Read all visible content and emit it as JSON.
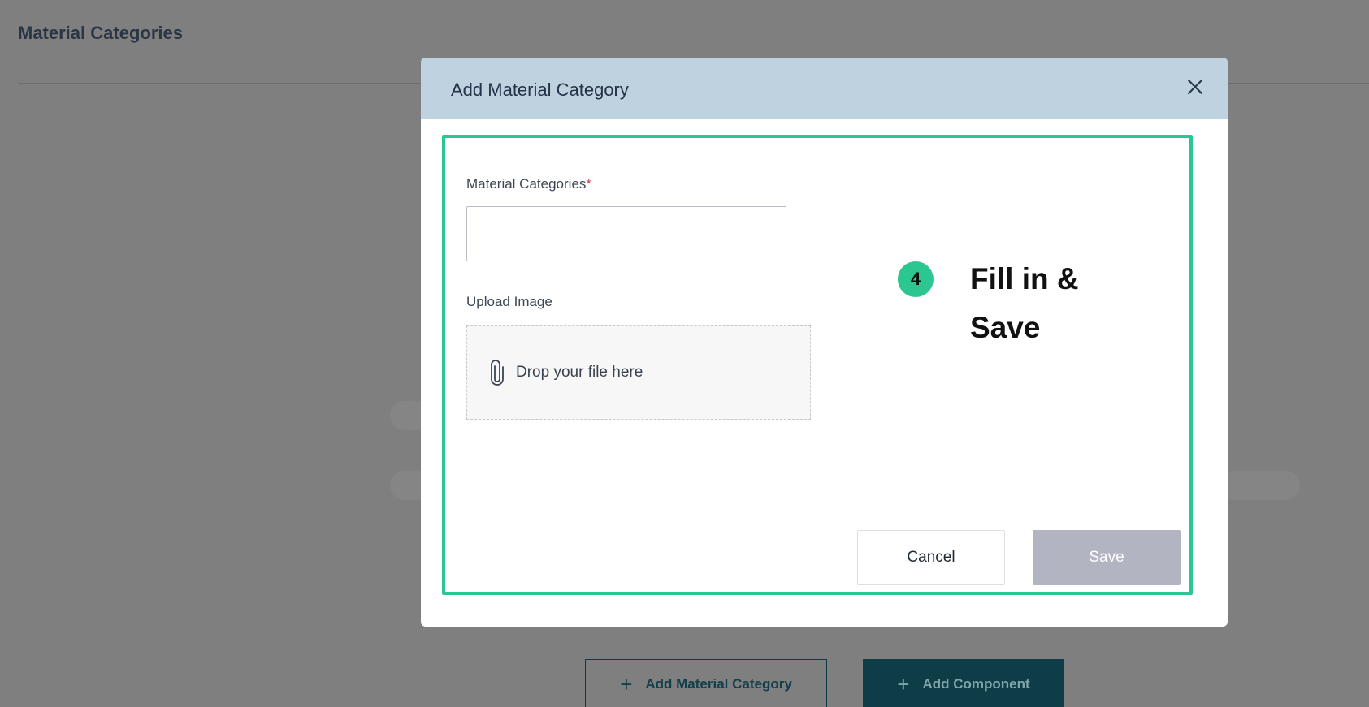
{
  "page": {
    "title": "Material Categories"
  },
  "footer": {
    "add_material_category_label": "Add Material Category",
    "add_component_label": "Add Component",
    "plus_glyph": "+"
  },
  "modal": {
    "title": "Add Material Category",
    "close_glyph": "×",
    "category_field": {
      "label": "Material Categories",
      "required_marker": "*",
      "value": "",
      "placeholder": ""
    },
    "upload": {
      "label": "Upload Image",
      "dropzone_text": "Drop your file here",
      "icon": "paperclip-icon"
    },
    "cancel_label": "Cancel",
    "save_label": "Save"
  },
  "annotation": {
    "step_number": "4",
    "instruction": "Fill in & Save",
    "color": "#2cc790"
  },
  "colors": {
    "overlay": "#7f7f7f",
    "modal_header": "#bed3df",
    "primary_dark": "#0e3d47",
    "save_disabled": "#b2b4c1",
    "required": "#d03a48"
  }
}
